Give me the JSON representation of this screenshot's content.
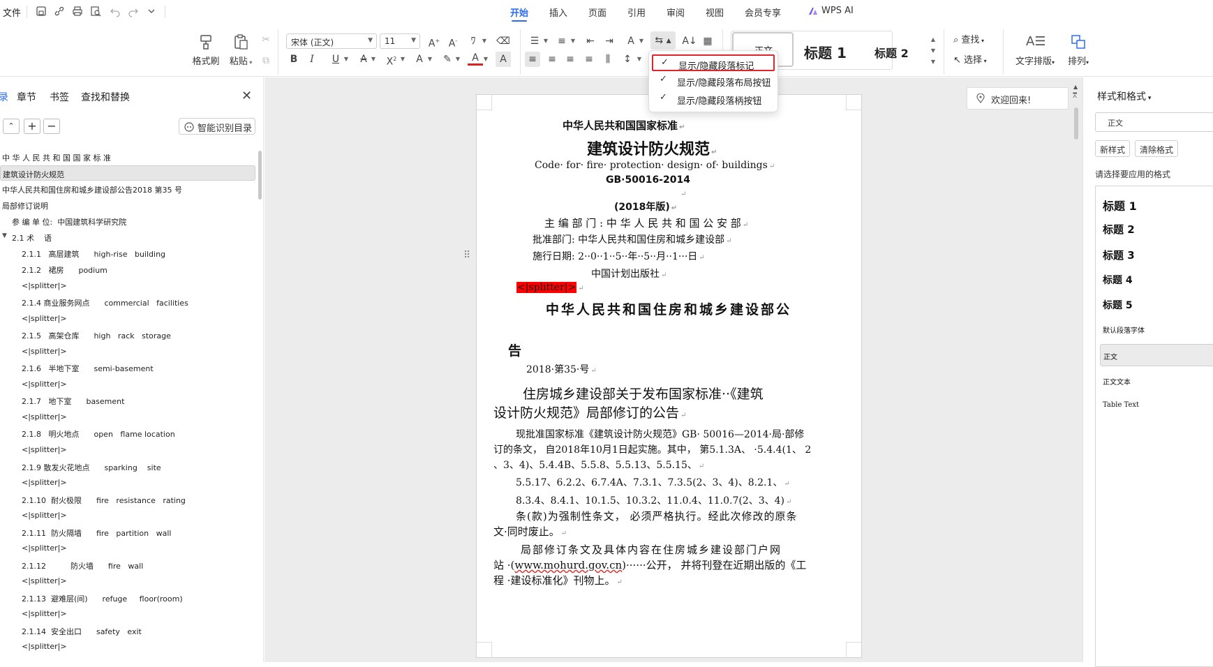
{
  "topbar": {
    "file_label": "文件",
    "tabs": [
      {
        "label": "开始",
        "active": true
      },
      {
        "label": "插入",
        "active": false
      },
      {
        "label": "页面",
        "active": false
      },
      {
        "label": "引用",
        "active": false
      },
      {
        "label": "审阅",
        "active": false
      },
      {
        "label": "视图",
        "active": false
      },
      {
        "label": "会员专享",
        "active": false
      },
      {
        "label": "WPS AI",
        "active": false
      }
    ]
  },
  "ribbon": {
    "format_painter": "格式刷",
    "paste": "粘贴",
    "font_name": "宋体 (正文)",
    "font_size": "11",
    "styles": [
      "正文",
      "标题 1",
      "标题 2"
    ],
    "find": "查找",
    "select": "选择",
    "text_layout": "文字排版",
    "arrange": "排列"
  },
  "dropdown": {
    "items": [
      {
        "label": "显示/隐藏段落标记",
        "checked": true,
        "highlighted": true
      },
      {
        "label": "显示/隐藏段落布局按钮",
        "checked": true,
        "highlighted": false
      },
      {
        "label": "显示/隐藏段落柄按钮",
        "checked": true,
        "highlighted": false
      }
    ]
  },
  "left_panel": {
    "tabs": [
      "录",
      "章节",
      "书签",
      "查找和替换"
    ],
    "smart_toc_button": "智能识别目录",
    "toc": [
      {
        "text": "中 华 人 民 共 和 国 国 家 标 准",
        "selected": false
      },
      {
        "text": "建筑设计防火规范",
        "selected": true
      },
      {
        "text": "中华人民共和国住房和城乡建设部公告2018 第35 号",
        "selected": false
      },
      {
        "text": "局部修订说明",
        "selected": false
      },
      {
        "text": "参 编 单 位:  中国建筑科学研究院",
        "selected": false
      },
      {
        "text": "2.1 术    语",
        "selected": false
      },
      {
        "text": "2.1.1   高层建筑      high-rise   building",
        "selected": false
      },
      {
        "text": "2.1.2   裙房      podium",
        "selected": false
      },
      {
        "text": "<|splitter|>",
        "selected": false
      },
      {
        "text": "2.1.4 商业服务网点      commercial   facilities",
        "selected": false
      },
      {
        "text": "<|splitter|>",
        "selected": false
      },
      {
        "text": "2.1.5   高架仓库      high   rack   storage",
        "selected": false
      },
      {
        "text": "<|splitter|>",
        "selected": false
      },
      {
        "text": "2.1.6   半地下室      semi-basement",
        "selected": false
      },
      {
        "text": "<|splitter|>",
        "selected": false
      },
      {
        "text": "2.1.7   地下室      basement",
        "selected": false
      },
      {
        "text": "<|splitter|>",
        "selected": false
      },
      {
        "text": "2.1.8   明火地点      open   flame location",
        "selected": false
      },
      {
        "text": "<|splitter|>",
        "selected": false
      },
      {
        "text": "2.1.9 散发火花地点      sparking    site",
        "selected": false
      },
      {
        "text": "<|splitter|>",
        "selected": false
      },
      {
        "text": "2.1.10  耐火极限      fire   resistance   rating",
        "selected": false
      },
      {
        "text": "<|splitter|>",
        "selected": false
      },
      {
        "text": "2.1.11  防火隔墙      fire   partition   wall",
        "selected": false
      },
      {
        "text": "<|splitter|>",
        "selected": false
      },
      {
        "text": "2.1.12          防火墙      fire   wall",
        "selected": false
      },
      {
        "text": "<|splitter|>",
        "selected": false
      },
      {
        "text": "2.1.13  避难层(间)      refuge     floor(room)",
        "selected": false
      },
      {
        "text": "<|splitter|>",
        "selected": false
      },
      {
        "text": "2.1.14  安全出口      safety   exit",
        "selected": false
      },
      {
        "text": "<|splitter|>",
        "selected": false
      }
    ]
  },
  "document": {
    "line1": "中华人民共和国国家标准",
    "title": "建筑设计防火规范",
    "english_title": "Code· for· fire· protection· design· of· buildings",
    "code": "GB·50016-2014",
    "edition": "(2018年版)",
    "editor": "主 编 部 门 :    中 华 人 民 共 和 国 公 安 部",
    "approver": "批准部门:   中华人民共和国住房和城乡建设部",
    "effective": "施行日期:  2··0··1··5··年··5··月··1···日",
    "publisher": "中国计划出版社",
    "splitter": "<|splitter|>",
    "announce_title": "中华人民共和国住房和城乡建设部公",
    "announce_title_end": "告",
    "announce_no": "2018·第35·号",
    "notice_line1": "住房城乡建设部关于发布国家标准··《建筑",
    "notice_line2": "设计防火规范》局部修订的公告",
    "para1_l1": "现批准国家标准《建筑设计防火规范》GB· 50016—2014·局·部修",
    "para1_l2": "订的条文，  自2018年10月1日起实施。其中，  第5.1.3A、  ·5.4.4(1、 2",
    "para1_l3": "、3、4)、5.4.4B、5.5.8、5.5.13、5.5.15、",
    "para1_l4": "5.5.17、6.2.2、6.7.4A、7.3.1、7.3.5(2、3、4)、8.2.1、",
    "para1_l5": "8.3.4、8.4.1、10.1.5、10.3.2、11.0.4、11.0.7(2、3、4)",
    "para2_l1": "条(款)为强制性条文，  必须严格执行。经此次修改的原条",
    "para2_l2": "文·同时废止。",
    "para3_l1": "局部修订条文及具体内容在住房城乡建设部门户网",
    "para3_l2a": "站  ·(",
    "para3_link": "www.mohurd.gov.cn",
    "para3_l2b": ")······公开，  并将刊登在近期出版的《工",
    "para3_l3": "程  ·建设标准化》刊物上。"
  },
  "welcome": "欢迎回来!",
  "right_panel": {
    "title": "样式和格式",
    "current_style": "正文",
    "new_style": "新样式",
    "clear_format": "清除格式",
    "hint": "请选择要应用的格式",
    "styles": [
      {
        "label": "标题 1",
        "selected": false
      },
      {
        "label": "标题 2",
        "selected": false
      },
      {
        "label": "标题 3",
        "selected": false
      },
      {
        "label": "标题 4",
        "selected": false
      },
      {
        "label": "标题 5",
        "selected": false
      },
      {
        "label": "默认段落字体",
        "selected": false
      },
      {
        "label": "正文",
        "selected": true
      },
      {
        "label": "正文文本",
        "selected": false
      },
      {
        "label": "Table Text",
        "selected": false
      }
    ]
  },
  "colors": {
    "accent": "#2b6cf5",
    "highlight_border": "#e0242c",
    "splitter_bg": "#ff0000"
  }
}
